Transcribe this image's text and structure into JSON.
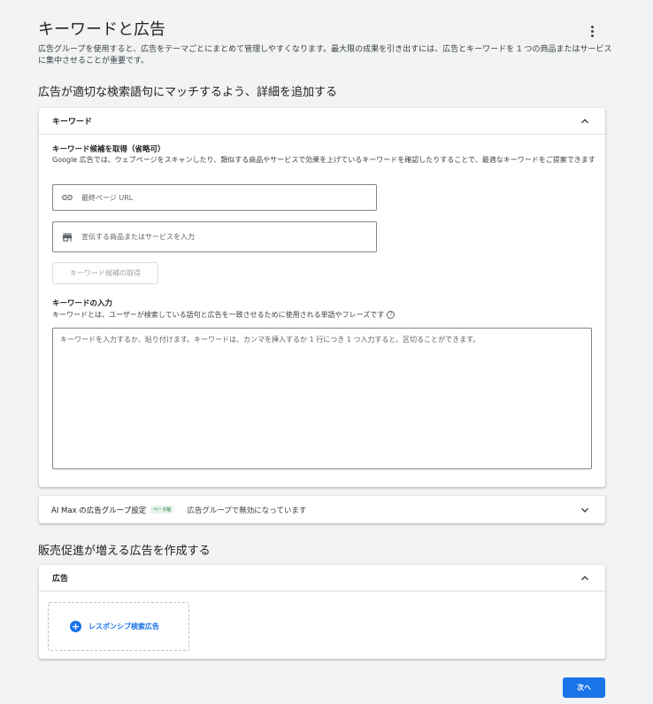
{
  "header": {
    "title": "キーワードと広告",
    "description": "広告グループを使用すると、広告をテーマごとにまとめて管理しやすくなります。最大限の成果を引き出すには、広告とキーワードを 1 つの商品またはサービスに集中させることが重要です。",
    "more_icon": "more-vert-icon"
  },
  "section1": {
    "heading": "広告が適切な検索語句にマッチするよう、詳細を追加する"
  },
  "keywords_card": {
    "title": "キーワード",
    "suggestions": {
      "title": "キーワード候補を取得（省略可）",
      "description": "Google 広告では、ウェブページをスキャンしたり、類似する商品やサービスで効果を上げているキーワードを確認したりすることで、最適なキーワードをご提案できます",
      "url_placeholder": "最終ページ URL",
      "product_placeholder": "宣伝する商品またはサービスを入力",
      "get_button": "キーワード候補の取得"
    },
    "entry": {
      "title": "キーワードの入力",
      "description": "キーワードとは、ユーザーが検索している語句と広告を一致させるために使用される単語やフレーズです",
      "help_glyph": "?",
      "placeholder": "キーワードを入力するか、貼り付けます。キーワードは、カンマを挿入するか 1 行につき 1 つ入力すると、区切ることができます。"
    }
  },
  "ai_max": {
    "title": "AI Max の広告グループ設定",
    "badge": "ベータ版",
    "status": "広告グループで無効になっています"
  },
  "section2": {
    "heading": "販売促進が増える広告を作成する"
  },
  "ads_card": {
    "title": "広告",
    "add_plus": "+",
    "add_label": "レスポンシブ検索広告"
  },
  "footer": {
    "next_label": "次へ"
  },
  "colors": {
    "accent": "#1a73e8",
    "background": "#f1f3f4",
    "badge_bg": "#e6f4ea",
    "badge_text": "#137333"
  }
}
